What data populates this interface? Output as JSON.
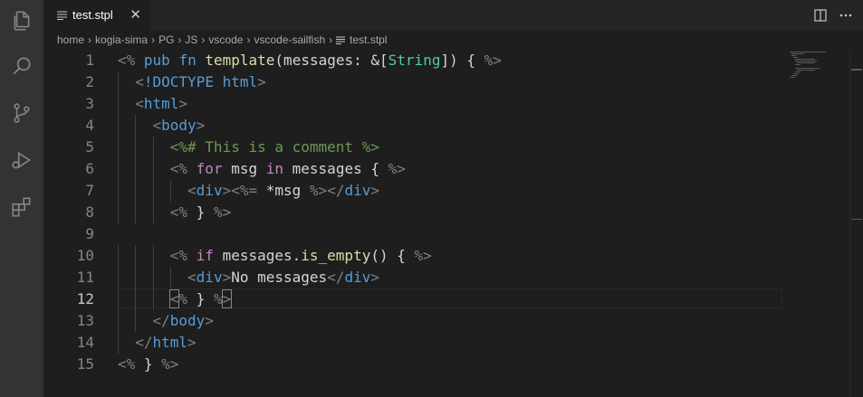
{
  "tab": {
    "file_icon": "lines-icon",
    "label": "test.stpl",
    "close": "✕"
  },
  "tab_actions": {
    "split": "split-editor-icon",
    "more": "more-icon"
  },
  "breadcrumb": [
    "home",
    "kogia-sima",
    "PG",
    "JS",
    "vscode",
    "vscode-sailfish",
    "test.stpl"
  ],
  "activity_bar": [
    "files-icon",
    "search-icon",
    "source-control-icon",
    "run-debug-icon",
    "extensions-icon"
  ],
  "current_line": 12,
  "code": [
    {
      "n": "1",
      "indent": 0,
      "tokens": [
        [
          "k-delim",
          "<%"
        ],
        [
          "k-txt",
          " "
        ],
        [
          "k-kw",
          "pub"
        ],
        [
          "k-txt",
          " "
        ],
        [
          "k-kw",
          "fn"
        ],
        [
          "k-txt",
          " "
        ],
        [
          "k-fn",
          "template"
        ],
        [
          "k-txt",
          "(messages: &["
        ],
        [
          "k-type",
          "String"
        ],
        [
          "k-txt",
          "]) { "
        ],
        [
          "k-delim",
          "%>"
        ]
      ]
    },
    {
      "n": "2",
      "indent": 1,
      "tokens": [
        [
          "k-delim",
          "<"
        ],
        [
          "k-tag",
          "!DOCTYPE"
        ],
        [
          "k-txt",
          " "
        ],
        [
          "k-tag",
          "html"
        ],
        [
          "k-delim",
          ">"
        ]
      ]
    },
    {
      "n": "3",
      "indent": 1,
      "tokens": [
        [
          "k-delim",
          "<"
        ],
        [
          "k-tag",
          "html"
        ],
        [
          "k-delim",
          ">"
        ]
      ]
    },
    {
      "n": "4",
      "indent": 2,
      "tokens": [
        [
          "k-delim",
          "<"
        ],
        [
          "k-tag",
          "body"
        ],
        [
          "k-delim",
          ">"
        ]
      ]
    },
    {
      "n": "5",
      "indent": 3,
      "tokens": [
        [
          "k-cmt",
          "<%# This is a comment %>"
        ]
      ]
    },
    {
      "n": "6",
      "indent": 3,
      "tokens": [
        [
          "k-delim",
          "<%"
        ],
        [
          "k-txt",
          " "
        ],
        [
          "k-ctrl",
          "for"
        ],
        [
          "k-txt",
          " msg "
        ],
        [
          "k-ctrl",
          "in"
        ],
        [
          "k-txt",
          " messages { "
        ],
        [
          "k-delim",
          "%>"
        ]
      ]
    },
    {
      "n": "7",
      "indent": 4,
      "tokens": [
        [
          "k-delim",
          "<"
        ],
        [
          "k-tag",
          "div"
        ],
        [
          "k-delim",
          ">"
        ],
        [
          "k-delim",
          "<%="
        ],
        [
          "k-txt",
          " *msg "
        ],
        [
          "k-delim",
          "%>"
        ],
        [
          "k-delim",
          "</"
        ],
        [
          "k-tag",
          "div"
        ],
        [
          "k-delim",
          ">"
        ]
      ]
    },
    {
      "n": "8",
      "indent": 3,
      "tokens": [
        [
          "k-delim",
          "<%"
        ],
        [
          "k-txt",
          " } "
        ],
        [
          "k-delim",
          "%>"
        ]
      ]
    },
    {
      "n": "9",
      "indent": 0,
      "tokens": []
    },
    {
      "n": "10",
      "indent": 3,
      "tokens": [
        [
          "k-delim",
          "<%"
        ],
        [
          "k-txt",
          " "
        ],
        [
          "k-ctrl",
          "if"
        ],
        [
          "k-txt",
          " messages."
        ],
        [
          "k-fn",
          "is_empty"
        ],
        [
          "k-txt",
          "() { "
        ],
        [
          "k-delim",
          "%>"
        ]
      ]
    },
    {
      "n": "11",
      "indent": 4,
      "tokens": [
        [
          "k-delim",
          "<"
        ],
        [
          "k-tag",
          "div"
        ],
        [
          "k-delim",
          ">"
        ],
        [
          "k-txt",
          "No messages"
        ],
        [
          "k-delim",
          "</"
        ],
        [
          "k-tag",
          "div"
        ],
        [
          "k-delim",
          ">"
        ]
      ]
    },
    {
      "n": "12",
      "indent": 3,
      "tokens": [
        [
          "k-delim bracket",
          "<"
        ],
        [
          "k-delim",
          "%"
        ],
        [
          "k-txt",
          " } "
        ],
        [
          "k-delim",
          "%"
        ],
        [
          "k-delim bracket",
          ">"
        ]
      ]
    },
    {
      "n": "13",
      "indent": 2,
      "tokens": [
        [
          "k-delim",
          "</"
        ],
        [
          "k-tag",
          "body"
        ],
        [
          "k-delim",
          ">"
        ]
      ]
    },
    {
      "n": "14",
      "indent": 1,
      "tokens": [
        [
          "k-delim",
          "</"
        ],
        [
          "k-tag",
          "html"
        ],
        [
          "k-delim",
          ">"
        ]
      ]
    },
    {
      "n": "15",
      "indent": 0,
      "tokens": [
        [
          "k-delim",
          "<%"
        ],
        [
          "k-txt",
          " } "
        ],
        [
          "k-delim",
          "%>"
        ]
      ]
    }
  ]
}
